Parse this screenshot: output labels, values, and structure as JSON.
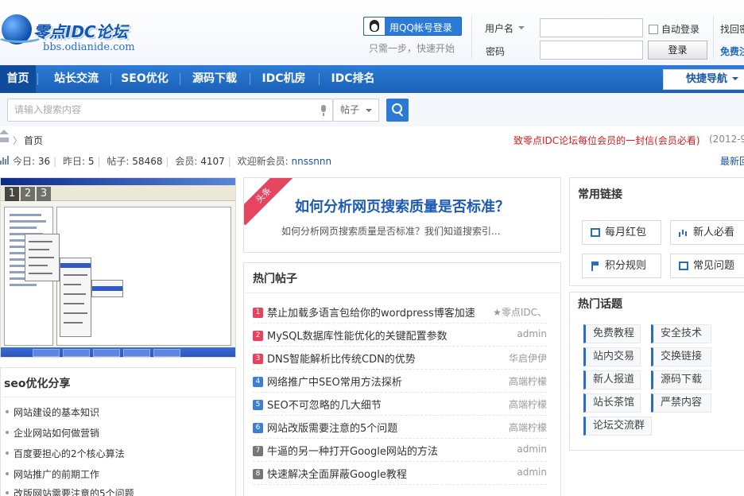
{
  "site": {
    "logo_name": "零点IDC论坛",
    "logo_url": "bbs.odianide.com"
  },
  "login": {
    "qq_button": "用QQ帐号登录",
    "qq_tip": "只需一步，快速开始",
    "username_label": "用户名",
    "password_label": "密码",
    "auto_login": "自动登录",
    "login_button": "登录",
    "find_password": "找回密码",
    "register": "免费注册"
  },
  "nav": {
    "items": [
      "首页",
      "站长交流",
      "SEO优化",
      "源码下载",
      "IDC机房",
      "IDC排名"
    ],
    "quick_nav": "快捷导航"
  },
  "search": {
    "placeholder": "请输入搜索内容",
    "type": "帖子"
  },
  "breadcrumb": {
    "home": "首页",
    "notice": "致零点IDC论坛每位会员的一封信(会员必看)",
    "notice_date": "(2012-9"
  },
  "stats": {
    "today_label": "今日:",
    "today": "36",
    "yesterday_label": "昨日:",
    "yesterday": "5",
    "posts_label": "帖子:",
    "posts": "58468",
    "members_label": "会员:",
    "members": "4107",
    "welcome_label": "欢迎新会员:",
    "newest_member": "nnssnnn",
    "newest_reply": "最新回"
  },
  "slideshow": {
    "pages": [
      "1",
      "2",
      "3"
    ],
    "active_page": "1"
  },
  "seo": {
    "title": "seo优化分享",
    "items": [
      "网站建设的基本知识",
      "企业网站如何做营销",
      "百度要担心的2个核心算法",
      "网站推广的前期工作",
      "改版网站需要注意的5个问题"
    ]
  },
  "headline": {
    "ribbon": "头条",
    "title": "如何分析网页搜索质量是否标准？",
    "desc": "如何分析网页搜索质量是否标准？我们知道搜索引..."
  },
  "hot_posts": {
    "title": "热门帖子",
    "items": [
      {
        "rank": "1",
        "title": "禁止加载多语言包给你的wordpress博客加速",
        "author": "★零点IDC、"
      },
      {
        "rank": "2",
        "title": "MySQL数据库性能优化的关键配置参数",
        "author": "admin"
      },
      {
        "rank": "3",
        "title": "DNS智能解析比传统CDN的优势",
        "author": "华启伊伊"
      },
      {
        "rank": "4",
        "title": "网络推广中SEO常用方法探析",
        "author": "高端柠檬"
      },
      {
        "rank": "5",
        "title": "SEO不可忽略的几大细节",
        "author": "高端柠檬"
      },
      {
        "rank": "6",
        "title": "网站改版需要注意的5个问题",
        "author": "高端柠檬"
      },
      {
        "rank": "7",
        "title": "牛逼的另一种打开Google网站的方法",
        "author": "admin"
      },
      {
        "rank": "8",
        "title": "快速解决全面屏蔽Google教程",
        "author": "admin"
      }
    ],
    "rank_colors": [
      "#e8435e",
      "#e8435e",
      "#e8435e",
      "#3f7fd0",
      "#3f7fd0",
      "#3f7fd0",
      "#777777",
      "#777777"
    ]
  },
  "links": {
    "title": "常用链接",
    "items": [
      "每月红包",
      "新人必看",
      "积分规则",
      "常见问题"
    ]
  },
  "topics": {
    "title": "热门话题",
    "items": [
      "免费教程",
      "安全技术",
      "站内交易",
      "交换链接",
      "新人报道",
      "源码下载",
      "站长茶馆",
      "严禁内容",
      "论坛交流群"
    ]
  },
  "colors": {
    "brand_blue": "#2a7ad6",
    "notice_red": "#d21c1c"
  }
}
